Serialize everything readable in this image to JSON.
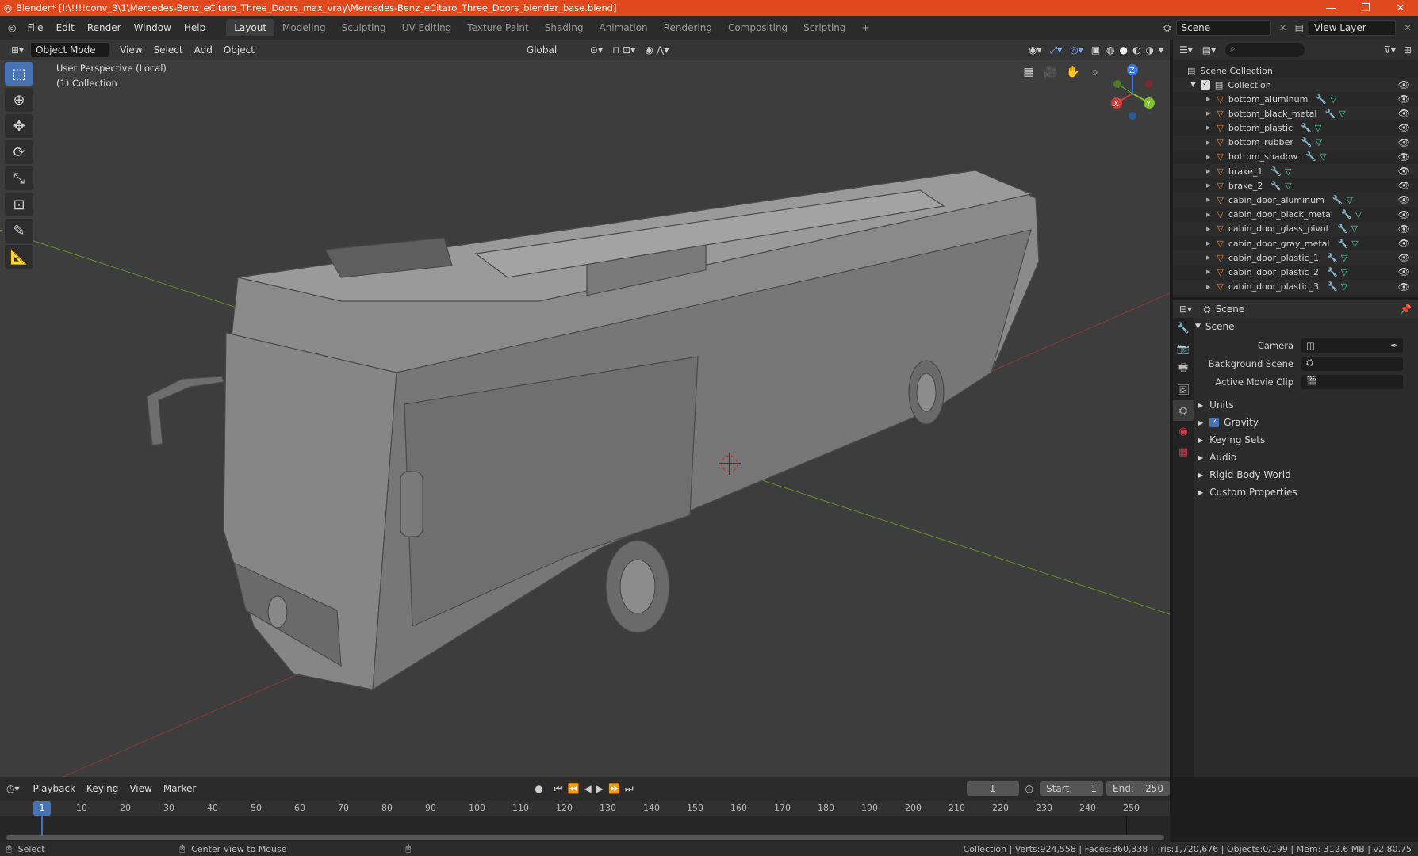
{
  "window": {
    "title": "Blender* [I:\\!!!!conv_3\\1\\Mercedes-Benz_eCitaro_Three_Doors_max_vray\\Mercedes-Benz_eCitaro_Three_Doors_blender_base.blend]",
    "minimize": "—",
    "maximize": "❐",
    "close": "✕"
  },
  "menu": [
    "File",
    "Edit",
    "Render",
    "Window",
    "Help"
  ],
  "workspaces": [
    "Layout",
    "Modeling",
    "Sculpting",
    "UV Editing",
    "Texture Paint",
    "Shading",
    "Animation",
    "Rendering",
    "Compositing",
    "Scripting"
  ],
  "active_workspace": "Layout",
  "add_workspace": "+",
  "scene_selector": "Scene",
  "view_layer_selector": "View Layer",
  "viewport": {
    "mode": "Object Mode",
    "menus": [
      "View",
      "Select",
      "Add",
      "Object"
    ],
    "orientation": "Global",
    "overlay_line1": "User Perspective (Local)",
    "overlay_line2": "(1) Collection",
    "axis_x": "X",
    "axis_y": "Y",
    "axis_z": "Z"
  },
  "outliner": {
    "root": "Scene Collection",
    "collection": "Collection",
    "items": [
      "bottom_aluminum",
      "bottom_black_metal",
      "bottom_plastic",
      "bottom_rubber",
      "bottom_shadow",
      "brake_1",
      "brake_2",
      "cabin_door_aluminum",
      "cabin_door_black_metal",
      "cabin_door_glass_pivot",
      "cabin_door_gray_metal",
      "cabin_door_plastic_1",
      "cabin_door_plastic_2",
      "cabin_door_plastic_3"
    ]
  },
  "properties": {
    "context": "Scene",
    "panel": "Scene",
    "camera_label": "Camera",
    "background_scene_label": "Background Scene",
    "active_movie_clip_label": "Active Movie Clip",
    "sections": [
      "Units",
      "Gravity",
      "Keying Sets",
      "Audio",
      "Rigid Body World",
      "Custom Properties"
    ],
    "gravity_enabled": true
  },
  "timeline": {
    "menus": [
      "Playback",
      "Keying",
      "View",
      "Marker"
    ],
    "current_frame": "1",
    "start_label": "Start:",
    "start_value": "1",
    "end_label": "End:",
    "end_value": "250",
    "ruler": [
      "10",
      "20",
      "30",
      "40",
      "50",
      "60",
      "70",
      "80",
      "90",
      "100",
      "110",
      "120",
      "130",
      "140",
      "150",
      "160",
      "170",
      "180",
      "190",
      "200",
      "210",
      "220",
      "230",
      "240",
      "250"
    ],
    "playhead": "1"
  },
  "status": {
    "left": "Select",
    "middle": "Center View to Mouse",
    "right": "Collection | Verts:924,558 | Faces:860,338 | Tris:1,720,676 | Objects:0/199 | Mem: 312.6 MB | v2.80.75"
  },
  "colors": {
    "titlebar": "#e0491d",
    "accent": "#4772b3",
    "mesh_icon": "#e8883a",
    "modifier_icon": "#6e9cff",
    "vertex_icon": "#4fd1a5"
  }
}
